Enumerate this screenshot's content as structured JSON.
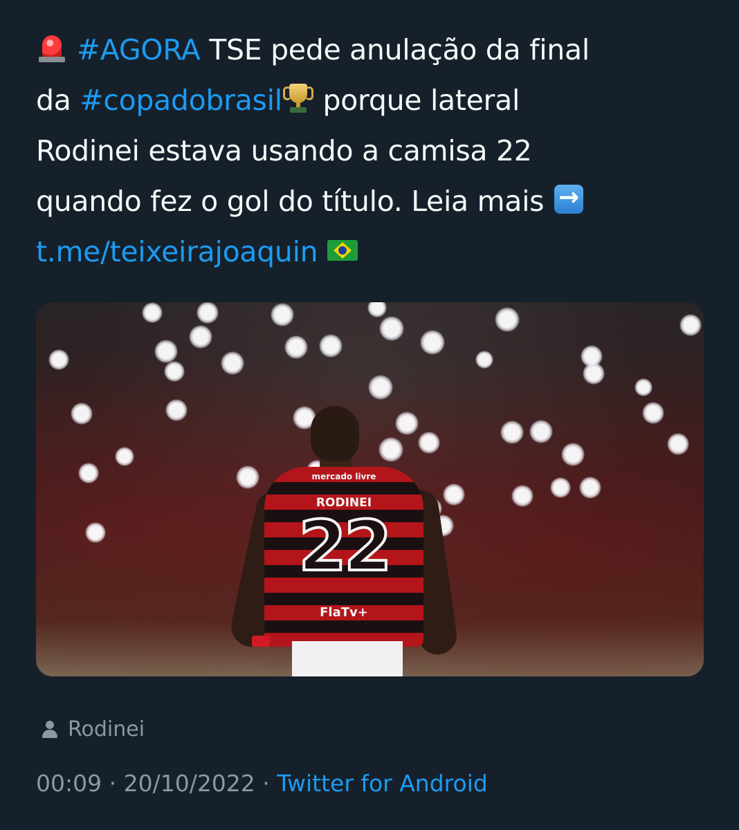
{
  "tweet": {
    "lines": [
      [
        {
          "type": "icon",
          "name": "police-siren-icon"
        },
        {
          "type": "text",
          "value": " "
        },
        {
          "type": "link",
          "value": "#AGORA"
        },
        {
          "type": "text",
          "value": " TSE pede anulação da final"
        }
      ],
      [
        {
          "type": "text",
          "value": "da "
        },
        {
          "type": "link",
          "value": "#copadobrasil"
        },
        {
          "type": "icon",
          "name": "trophy-icon"
        },
        {
          "type": "text",
          "value": " porque lateral"
        }
      ],
      [
        {
          "type": "text",
          "value": "Rodinei estava usando a camisa 22"
        }
      ],
      [
        {
          "type": "text",
          "value": "quando fez o gol do título. Leia mais "
        },
        {
          "type": "icon",
          "name": "right-arrow-icon"
        }
      ],
      [
        {
          "type": "link",
          "value": "t.me/teixeirajoaquin"
        },
        {
          "type": "text",
          "value": " "
        },
        {
          "type": "icon",
          "name": "brazil-flag-icon"
        }
      ]
    ]
  },
  "media": {
    "player_name": "RODINEI",
    "player_number": "22",
    "sponsor_top": "mercado livre",
    "sponsor_bottom": "FlaTv+"
  },
  "tagged": {
    "icon": "person-icon",
    "name": "Rodinei"
  },
  "meta": {
    "time": "00:09",
    "separator": " · ",
    "date": "20/10/2022",
    "source": "Twitter for Android"
  },
  "colors": {
    "background": "#15202b",
    "text": "#f7f9f9",
    "link": "#1d9bf0",
    "muted": "#8b98a5"
  }
}
